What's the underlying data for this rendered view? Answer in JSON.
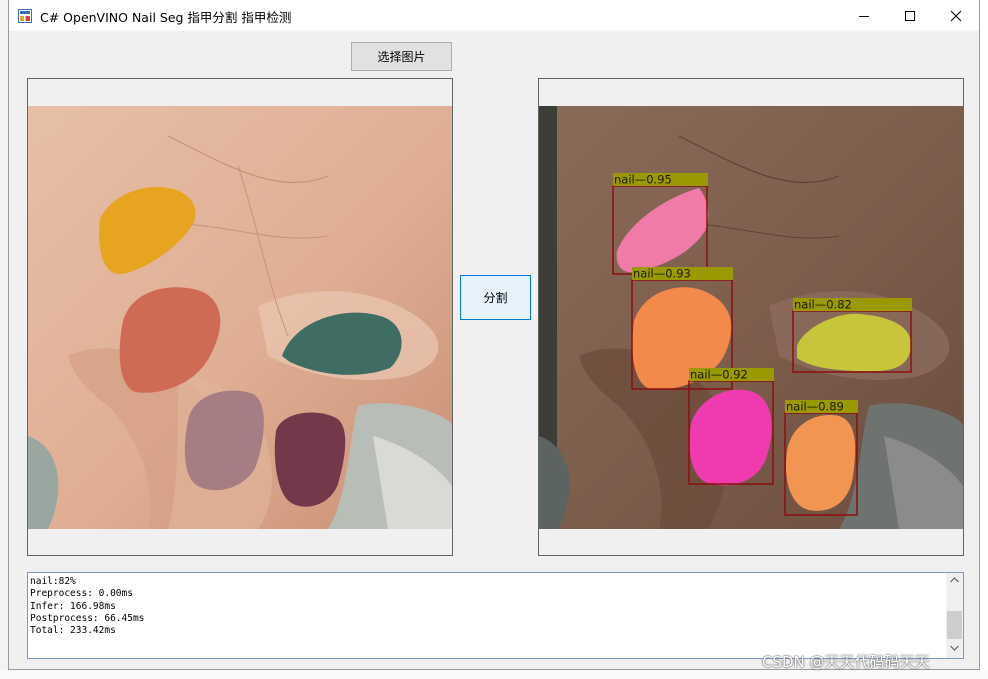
{
  "window": {
    "title": "C# OpenVINO Nail Seg 指甲分割  指甲检测"
  },
  "toolbar": {
    "select_image_label": "选择图片",
    "segment_label": "分割"
  },
  "detections": [
    {
      "class": "nail",
      "score": 0.95,
      "label": "nail—0.95"
    },
    {
      "class": "nail",
      "score": 0.93,
      "label": "nail—0.93"
    },
    {
      "class": "nail",
      "score": 0.82,
      "label": "nail—0.82"
    },
    {
      "class": "nail",
      "score": 0.92,
      "label": "nail—0.92"
    },
    {
      "class": "nail",
      "score": 0.89,
      "label": "nail—0.89"
    }
  ],
  "log": {
    "text": "nail:82%\nPreprocess: 0.00ms\nInfer: 166.98ms\nPostprocess: 66.45ms\nTotal: 233.42ms"
  },
  "watermark": "CSDN @天天代码码天天",
  "colors": {
    "box": "#8b0f0f",
    "label_bg": "#9a9a00",
    "nail_yellow": "#e6a420",
    "nail_coral": "#cf6a55",
    "nail_teal": "#3f6d63",
    "nail_mauve": "#a77d84",
    "nail_wine": "#73384a",
    "mask_pink": "#f07aa8",
    "mask_orange": "#f3894a",
    "mask_lime": "#c7c63a",
    "mask_magenta": "#f03ab0",
    "mask_orange2": "#f39552"
  }
}
